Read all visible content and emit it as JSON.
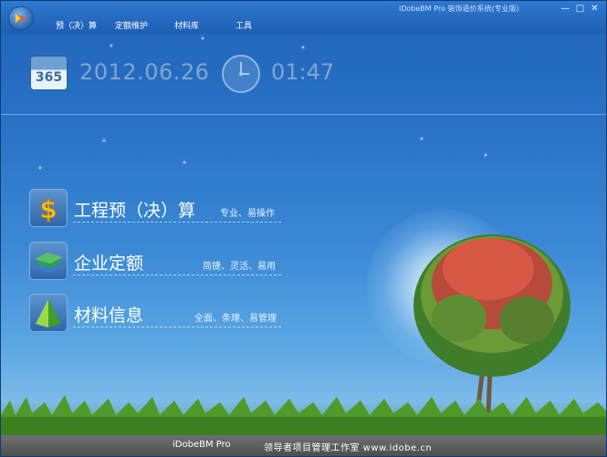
{
  "window": {
    "title": "iDobeBM Pro  装饰造价系统(专业版)",
    "minimize_label": "—",
    "maximize_label": "□",
    "close_label": "✕"
  },
  "menu": [
    {
      "label": "预（决）算"
    },
    {
      "label": "定额维护"
    },
    {
      "label": "材料库"
    },
    {
      "label": "工具"
    }
  ],
  "calendar_icon_text": "365",
  "date": "2012.06.26",
  "time": "01:47",
  "features": [
    {
      "title": "工程预（决）算",
      "desc": "专业、易操作",
      "icon": "dollar-icon"
    },
    {
      "title": "企业定额",
      "desc": "简捷、灵活、易用",
      "icon": "books-icon"
    },
    {
      "title": "材料信息",
      "desc": "全面、条理、易管理",
      "icon": "pyramid-icon"
    }
  ],
  "footer": {
    "product": "iDobeBM Pro",
    "studio": "领导者项目管理工作室 www.idobe.cn"
  },
  "colors": {
    "sky_top": "#1f63b9",
    "sky_bottom": "#7dbbe9",
    "footer_bg": "#5a5c5d",
    "text_muted": "#7fa6d2"
  }
}
